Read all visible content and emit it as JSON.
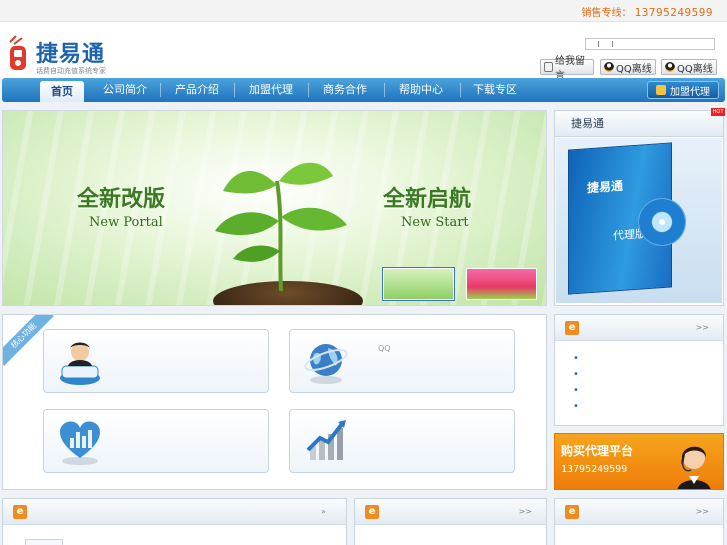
{
  "topbar": {
    "hotline_label": "销售专线：",
    "hotline_number": "13795249599"
  },
  "header": {
    "logo_title": "捷易通",
    "logo_subtitle": "话费自动充值系统专家",
    "message_button": "给我留言",
    "qq_buttons": [
      "QQ离线",
      "QQ离线"
    ]
  },
  "nav": {
    "items": [
      "首页",
      "公司简介",
      "产品介绍",
      "加盟代理",
      "商务合作",
      "帮助中心",
      "下载专区"
    ],
    "active_index": 0,
    "agent_button": "加盟代理"
  },
  "banner": {
    "left_cn": "全新改版",
    "left_en": "New Portal",
    "right_cn": "全新启航",
    "right_en": "New Start"
  },
  "product": {
    "title": "捷易通",
    "hot_badge": "HOT",
    "box_brand": "捷易通",
    "box_edition": "代理版"
  },
  "core": {
    "ribbon": "核心功能",
    "card_text": "QQ"
  },
  "news": {
    "more": ">>"
  },
  "buy": {
    "title": "购买代理平台",
    "phone": "13795249599"
  },
  "bottom": {
    "more_1": "»",
    "more_2": ">>",
    "more_3": ">>"
  },
  "colors": {
    "nav_blue": "#1f73bd",
    "orange": "#ee7d0a",
    "hotline": "#e86a10"
  }
}
